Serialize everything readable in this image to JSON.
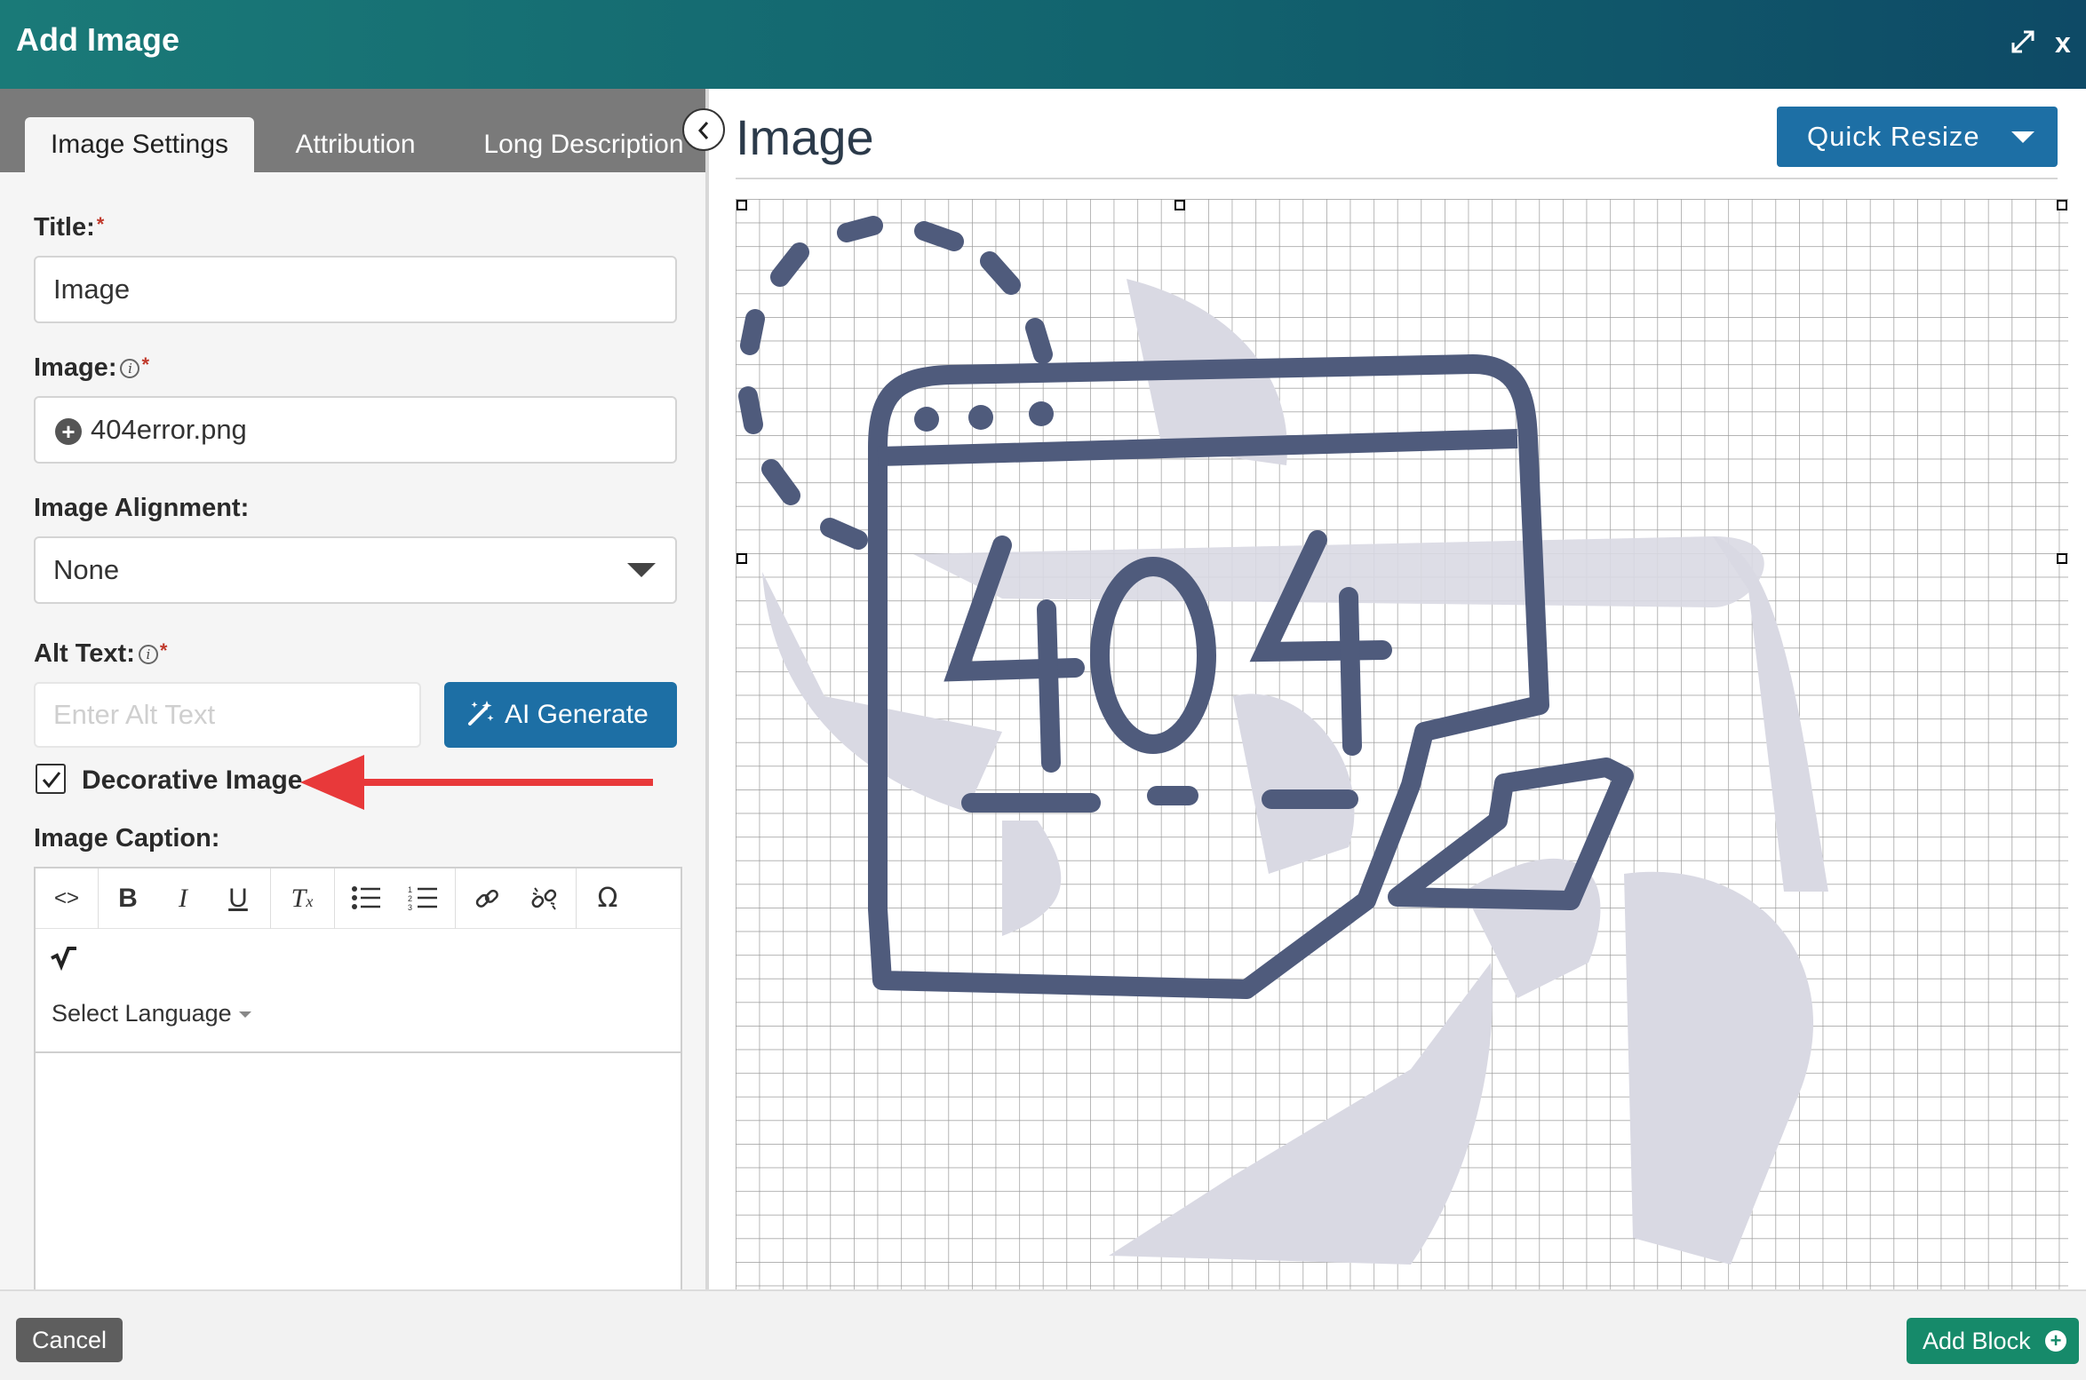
{
  "dialog": {
    "title": "Add Image",
    "expand_icon": "expand-arrows-icon",
    "close_label": "x"
  },
  "tabs": [
    {
      "label": "Image Settings",
      "active": true
    },
    {
      "label": "Attribution",
      "active": false
    },
    {
      "label": "Long Description",
      "active": false
    }
  ],
  "form": {
    "title_label": "Title:",
    "title_value": "Image",
    "image_label": "Image:",
    "image_value": "404error.png",
    "alignment_label": "Image Alignment:",
    "alignment_value": "None",
    "alt_label": "Alt Text:",
    "alt_placeholder": "Enter Alt Text",
    "ai_generate_label": "AI Generate",
    "decorative_label": "Decorative Image",
    "decorative_checked": true,
    "caption_label": "Image Caption:",
    "required_mark": "*",
    "info_mark": "i"
  },
  "editor": {
    "toolbar": [
      {
        "icon": "source-code-icon",
        "glyph": "<>"
      },
      {
        "icon": "bold-icon",
        "glyph": "B"
      },
      {
        "icon": "italic-icon",
        "glyph": "I"
      },
      {
        "icon": "underline-icon",
        "glyph": "U"
      },
      {
        "icon": "clear-format-icon",
        "glyph": "Tx"
      },
      {
        "icon": "bulleted-list-icon",
        "glyph": "•"
      },
      {
        "icon": "numbered-list-icon",
        "glyph": "1"
      },
      {
        "icon": "link-icon",
        "glyph": "link"
      },
      {
        "icon": "unlink-icon",
        "glyph": "unlink"
      },
      {
        "icon": "special-char-icon",
        "glyph": "Ω"
      },
      {
        "icon": "math-icon",
        "glyph": "√"
      }
    ],
    "language_label": "Select Language"
  },
  "preview": {
    "heading": "Image",
    "quick_resize_label": "Quick Resize",
    "image_text": "404"
  },
  "footer": {
    "cancel_label": "Cancel",
    "add_block_label": "Add Block"
  },
  "colors": {
    "header_start": "#1a7a78",
    "header_end": "#0e4a66",
    "primary_button": "#1d6fa5",
    "add_block": "#168a6a",
    "annotation_arrow": "#e8393a",
    "illustration_stroke": "#4f5b7c",
    "illustration_shadow": "#d9d9e3"
  }
}
